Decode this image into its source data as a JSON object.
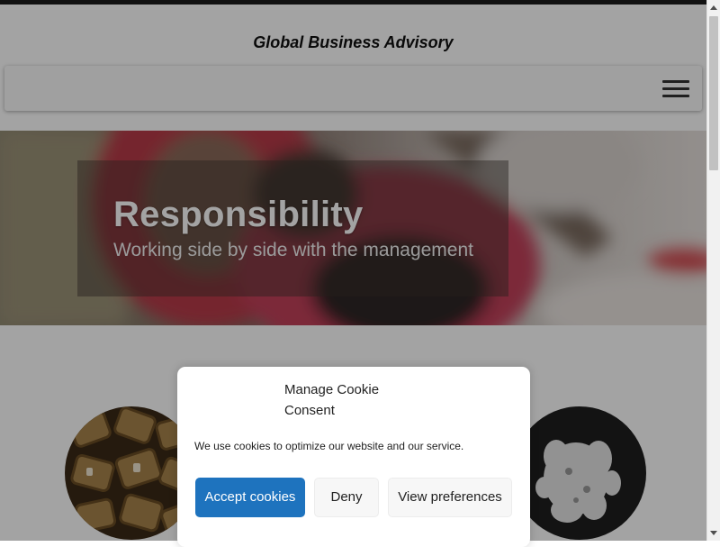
{
  "site": {
    "title": "Global Business Advisory"
  },
  "nav": {
    "menu_icon": "hamburger-menu-icon"
  },
  "hero": {
    "heading": "Responsibility",
    "subheading": "Working side by side with the management"
  },
  "cookie_consent": {
    "title": "Manage Cookie Consent",
    "message": "We use cookies to optimize our website and our service.",
    "accept_label": "Accept cookies",
    "deny_label": "Deny",
    "preferences_label": "View preferences"
  },
  "colors": {
    "accent": "#1e73be",
    "topbar": "#1b1b1b",
    "overlay": "rgba(0,0,0,0.36)"
  }
}
